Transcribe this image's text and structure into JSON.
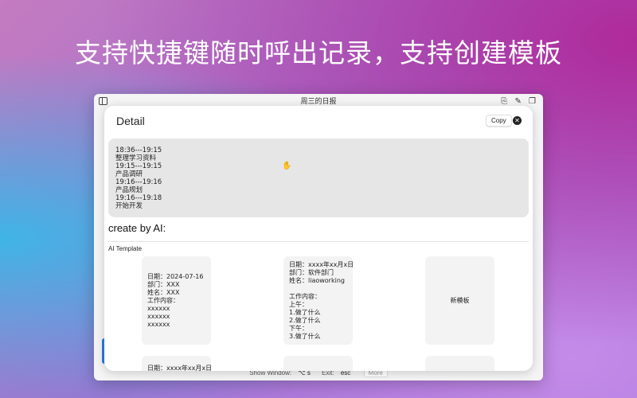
{
  "headline": "支持快捷键随时呼出记录，支持创建模板",
  "window": {
    "title": "周三的日报",
    "toolbar_icons": "⎘ ✎ ❐"
  },
  "footer": {
    "show_window_label": "Show Window:",
    "show_window_key": "⌥ s",
    "exit_label": "Exit:",
    "exit_key": "esc",
    "more": "More"
  },
  "modal": {
    "title": "Detail",
    "copy": "Copy",
    "close": "✕",
    "record": "18:36---19:15\n整理学习资料\n19:15---19:15\n产品调研\n19:16---19:16\n产品规划\n19:16---19:18\n开始开发",
    "ai_heading": "create by AI:",
    "ai_template": "AI Template",
    "cards": [
      "日期：2024-07-16\n部门：XXX\n姓名：XXX\n工作内容：\nxxxxxx\nxxxxxx\nxxxxxx",
      "日期：xxxx年xx月x日\n部门：软件部门\n姓名：liaoworking\n\n工作内容：\n上午：\n1.做了什么\n2.做了什么\n下午：\n3.做了什么",
      "新模板"
    ],
    "cards_row2": [
      "日期：xxxx年xx月x日",
      "",
      ""
    ]
  }
}
